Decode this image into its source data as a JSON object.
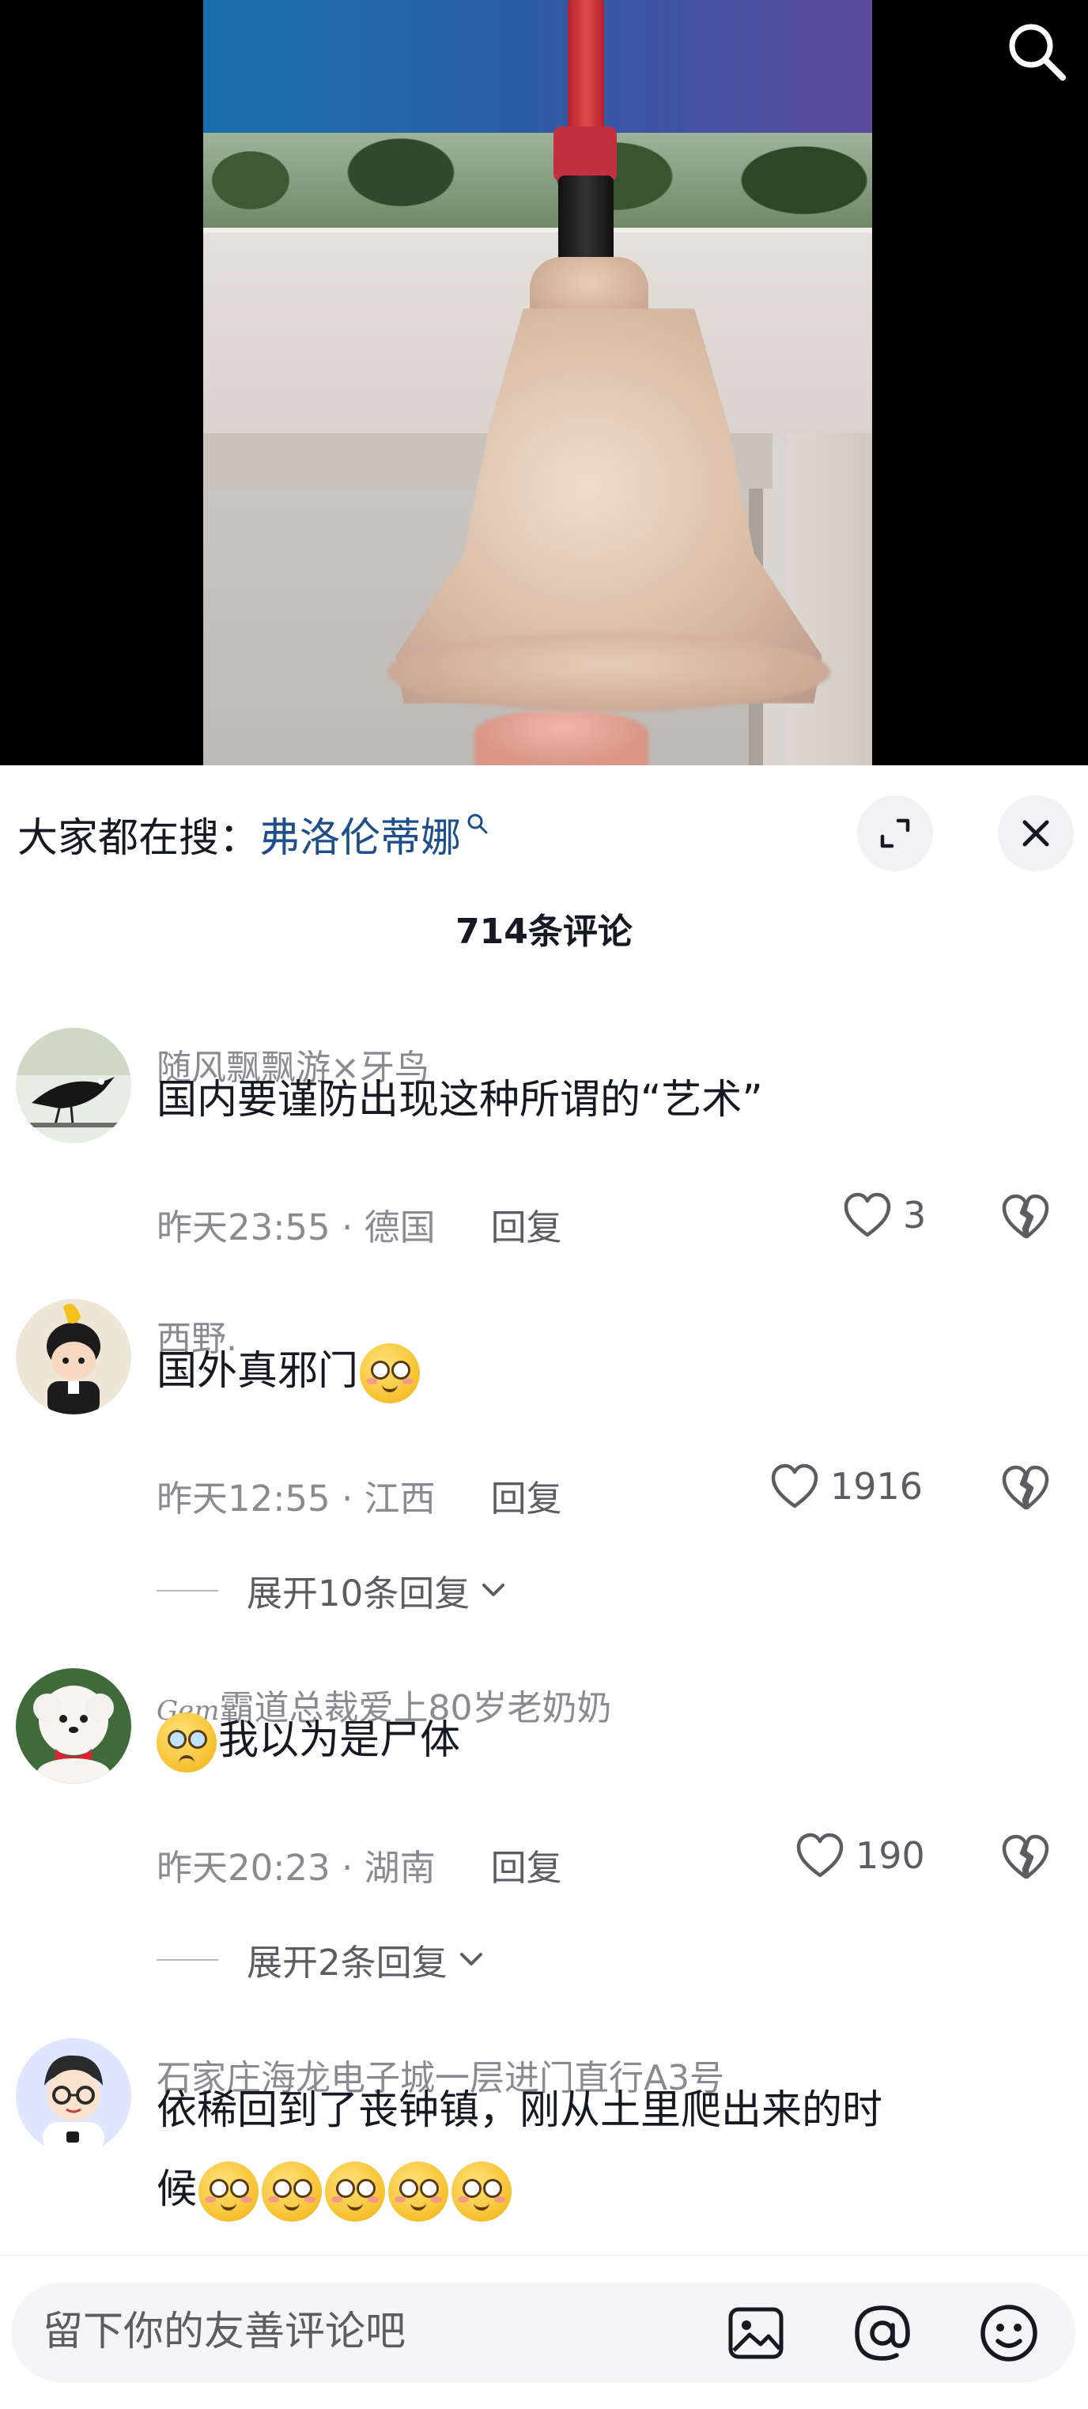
{
  "video": {
    "search_icon": "search-icon"
  },
  "trending": {
    "label": "大家都在搜：",
    "keyword": "弗洛伦蒂娜",
    "keyword_icon": "search-icon"
  },
  "header": {
    "expand_icon": "expand-icon",
    "close_icon": "close-icon",
    "comment_count": "714条评论"
  },
  "comments": [
    {
      "username": "随风飘飘游×牙鸟",
      "content": "国内要谨防出现这种所谓的“艺术”",
      "time_location": "昨天23:55 · 德国",
      "reply_label": "回复",
      "likes": "3"
    },
    {
      "username": "西野.",
      "content": "国外真邪门",
      "time_location": "昨天12:55 · 江西",
      "reply_label": "回复",
      "likes": "1916",
      "expand_label": "展开10条回复"
    },
    {
      "username": "霸道总裁爱上80岁老奶奶",
      "username_prefix": "Gem",
      "content": "我以为是尸体",
      "time_location": "昨天20:23 · 湖南",
      "reply_label": "回复",
      "likes": "190",
      "expand_label": "展开2条回复"
    },
    {
      "username": "石家庄海龙电子城一层进门直行A3号",
      "content_line1": "依稀回到了丧钟镇，刚从土里爬出来的时",
      "content_line2": "候"
    }
  ],
  "input": {
    "placeholder": "留下你的友善评论吧"
  },
  "colors": {
    "keyword": "#1e4f8a",
    "meta": "#8a8b91",
    "text": "#161823"
  }
}
